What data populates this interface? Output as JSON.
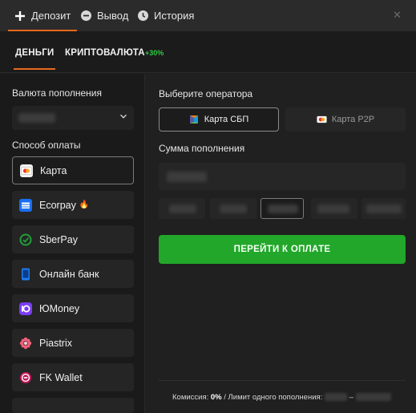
{
  "top_tabs": [
    {
      "label": "Депозит",
      "icon": "plus-icon",
      "active": true
    },
    {
      "label": "Вывод",
      "icon": "minus-circle-icon",
      "active": false
    },
    {
      "label": "История",
      "icon": "clock-icon",
      "active": false
    }
  ],
  "sub_tabs": [
    {
      "label": "ДЕНЬГИ",
      "active": true
    },
    {
      "label": "КРИПТОВАЛЮТА",
      "badge": "+30%",
      "active": false
    }
  ],
  "currency": {
    "label": "Валюта пополнения"
  },
  "payment": {
    "label": "Способ оплаты",
    "methods": [
      {
        "label": "Карта",
        "icon": "bank-card-icon",
        "selected": true
      },
      {
        "label": "Ecorpay",
        "icon": "ecorpay-icon",
        "suffix": "🔥"
      },
      {
        "label": "SberPay",
        "icon": "sberpay-icon"
      },
      {
        "label": "Онлайн банк",
        "icon": "phone-icon"
      },
      {
        "label": "ЮMoney",
        "icon": "yoomoney-icon"
      },
      {
        "label": "Piastrix",
        "icon": "piastrix-icon"
      },
      {
        "label": "FK Wallet",
        "icon": "fk-wallet-icon"
      }
    ]
  },
  "operator": {
    "label": "Выберите оператора",
    "options": [
      {
        "label": "Карта СБП",
        "icon": "sbp-icon",
        "selected": true
      },
      {
        "label": "Карта P2P",
        "icon": "mastercard-icon",
        "selected": false
      }
    ]
  },
  "amount": {
    "label": "Сумма пополнения"
  },
  "pay_button": {
    "label": "ПЕРЕЙТИ К ОПЛАТЕ"
  },
  "footer": {
    "commission_label": "Комиссия:",
    "commission_value": "0%",
    "limit_label": "/ Лимит одного пополнения:",
    "separator": "–"
  },
  "colors": {
    "accent": "#e8691c",
    "pay": "#22a72a",
    "badge": "#2ecc40"
  }
}
